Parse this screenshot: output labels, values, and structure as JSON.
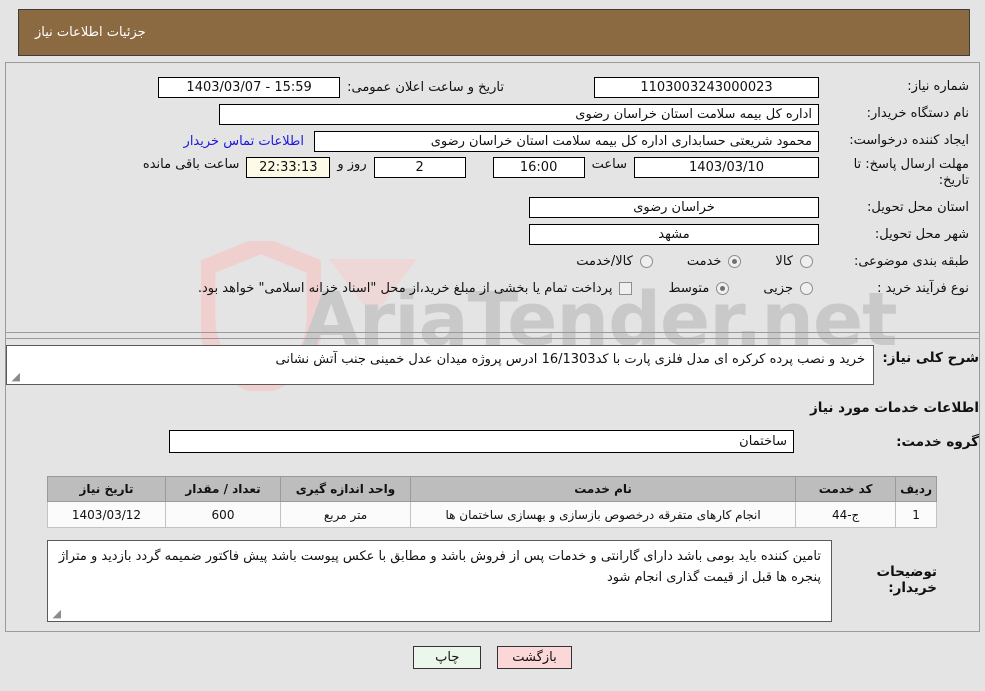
{
  "header": {
    "title": "جزئیات اطلاعات نیاز"
  },
  "watermark": {
    "text": "AriaTender.net"
  },
  "form": {
    "need_number_label": "شماره نیاز:",
    "need_number_value": "1103003243000023",
    "announce_datetime_label": "تاریخ و ساعت اعلان عمومی:",
    "announce_datetime_value": "15:59 - 1403/03/07",
    "buyer_org_label": "نام دستگاه خریدار:",
    "buyer_org_value": "اداره کل بیمه سلامت استان خراسان رضوی",
    "requester_label": "ایجاد کننده درخواست:",
    "requester_value": "محمود شریعتی حسابداری اداره کل بیمه سلامت استان خراسان رضوی",
    "contact_link": "اطلاعات تماس خریدار",
    "deadline_label": "مهلت ارسال پاسخ: تا تاریخ:",
    "deadline_date": "1403/03/10",
    "hour_label": "ساعت",
    "hour_value": "16:00",
    "days_value": "2",
    "days_label": "روز و",
    "remaining_time": "22:33:13",
    "remaining_label": "ساعت باقی مانده",
    "province_label": "استان محل تحویل:",
    "province_value": "خراسان رضوی",
    "city_label": "شهر محل تحویل:",
    "city_value": "مشهد",
    "category_label": "طبقه بندی موضوعی:",
    "category_options": [
      {
        "label": "کالا",
        "selected": false
      },
      {
        "label": "خدمت",
        "selected": true
      },
      {
        "label": "کالا/خدمت",
        "selected": false
      }
    ],
    "process_type_label": "نوع فرآیند خرید :",
    "process_type_options": [
      {
        "label": "جزیی",
        "selected": false
      },
      {
        "label": "متوسط",
        "selected": true
      }
    ],
    "treasury_checkbox_text": "پرداخت تمام یا بخشی از مبلغ خرید،از محل \"اسناد خزانه اسلامی\" خواهد بود.",
    "treasury_checked": false
  },
  "need_description": {
    "label": "شرح کلی نیاز:",
    "value": "خرید و نصب پرده کرکره ای مدل فلزی پارت با کد16/1303  ادرس پروژه میدان عدل خمینی جنب آتش نشانی"
  },
  "services_section": {
    "heading": "اطلاعات خدمات مورد نیاز",
    "group_label": "گروه خدمت:",
    "group_value": "ساختمان"
  },
  "table": {
    "columns": [
      "ردیف",
      "کد خدمت",
      "نام خدمت",
      "واحد اندازه گیری",
      "تعداد / مقدار",
      "تاریخ نیاز"
    ],
    "rows": [
      {
        "row_no": "1",
        "service_code": "ج-44",
        "service_name": "انجام کارهای متفرقه درخصوص بازسازی و بهسازی ساختمان ها",
        "unit": "متر مربع",
        "quantity": "600",
        "need_date": "1403/03/12"
      }
    ]
  },
  "buyer_notes": {
    "label": "توضیحات خریدار:",
    "value": "تامین کننده باید بومی باشد دارای گارانتی و خدمات پس از فروش باشد و مطابق با عکس پیوست باشد پیش فاکتور ضمیمه گردد بازدید و متراژ پنجره ها قبل از قیمت گذاری انجام شود"
  },
  "footer": {
    "print_label": "چاپ",
    "back_label": "بازگشت"
  },
  "colors": {
    "header_bg": "#8b6a42",
    "page_bg": "#e4e4e4",
    "link": "#1a18e0",
    "table_header_bg": "#bdbdbd",
    "print_btn_bg": "#eaf7ea",
    "back_btn_bg": "#fbd7d7"
  }
}
